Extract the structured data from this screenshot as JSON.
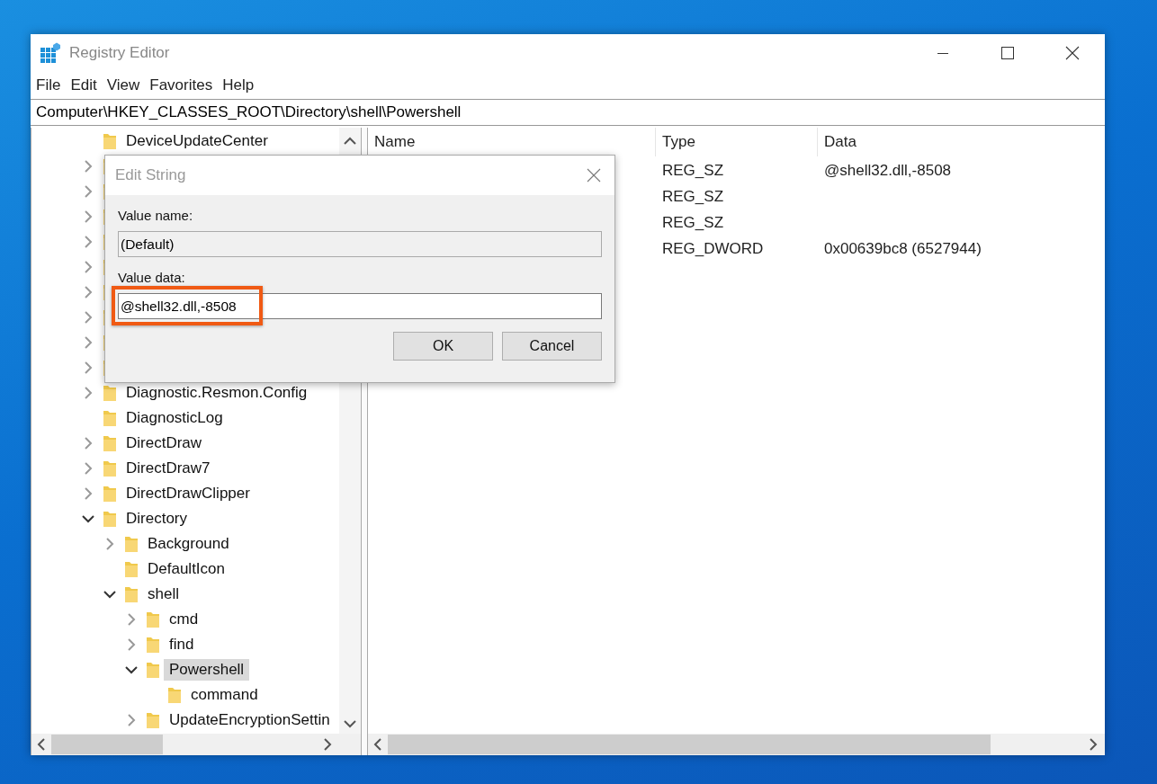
{
  "window": {
    "title": "Registry Editor"
  },
  "menu": [
    "File",
    "Edit",
    "View",
    "Favorites",
    "Help"
  ],
  "address": "Computer\\HKEY_CLASSES_ROOT\\Directory\\shell\\Powershell",
  "tree": [
    {
      "label": "DeviceUpdateCenter",
      "selected": false
    },
    {
      "expanded": false
    },
    {
      "expanded": false
    },
    {
      "expanded": false
    },
    {
      "expanded": false
    },
    {
      "expanded": false
    },
    {
      "expanded": false
    },
    {
      "expanded": false
    },
    {
      "expanded": false
    },
    {
      "expanded": false
    },
    {
      "label": "Diagnostic.Resmon.Config",
      "expanded": false,
      "selected": false
    },
    {
      "label": "DiagnosticLog",
      "selected": false
    },
    {
      "label": "DirectDraw",
      "expanded": false,
      "selected": false
    },
    {
      "label": "DirectDraw7",
      "expanded": false,
      "selected": false
    },
    {
      "label": "DirectDrawClipper",
      "expanded": false,
      "selected": false
    },
    {
      "label": "Directory",
      "expanded": true,
      "selected": false,
      "children": [
        {
          "label": "Background",
          "expanded": false,
          "selected": false
        },
        {
          "label": "DefaultIcon",
          "selected": false
        },
        {
          "label": "shell",
          "expanded": true,
          "selected": false,
          "children": [
            {
              "label": "cmd",
              "expanded": false,
              "selected": false
            },
            {
              "label": "find",
              "expanded": false,
              "selected": false
            },
            {
              "label": "Powershell",
              "expanded": true,
              "selected": true,
              "children": [
                {
                  "label": "command",
                  "selected": false
                }
              ]
            },
            {
              "label": "UpdateEncryptionSettin",
              "expanded": false,
              "selected": false
            }
          ]
        }
      ]
    }
  ],
  "table": {
    "columns": [
      "Name",
      "Type",
      "Data"
    ],
    "rows": [
      {
        "type": "REG_SZ",
        "data": "@shell32.dll,-8508"
      },
      {
        "type": "REG_SZ"
      },
      {
        "type": "REG_SZ"
      },
      {
        "type": "REG_DWORD",
        "data": "0x00639bc8 (6527944)"
      }
    ]
  },
  "dialog": {
    "title": "Edit String",
    "fields": [
      {
        "label": "Value name:",
        "value": "(Default)",
        "disabled": true,
        "highlighted": false
      },
      {
        "label": "Value data:",
        "value": "@shell32.dll,-8508",
        "disabled": false,
        "highlighted": true
      }
    ],
    "buttons": [
      "OK",
      "Cancel"
    ]
  }
}
